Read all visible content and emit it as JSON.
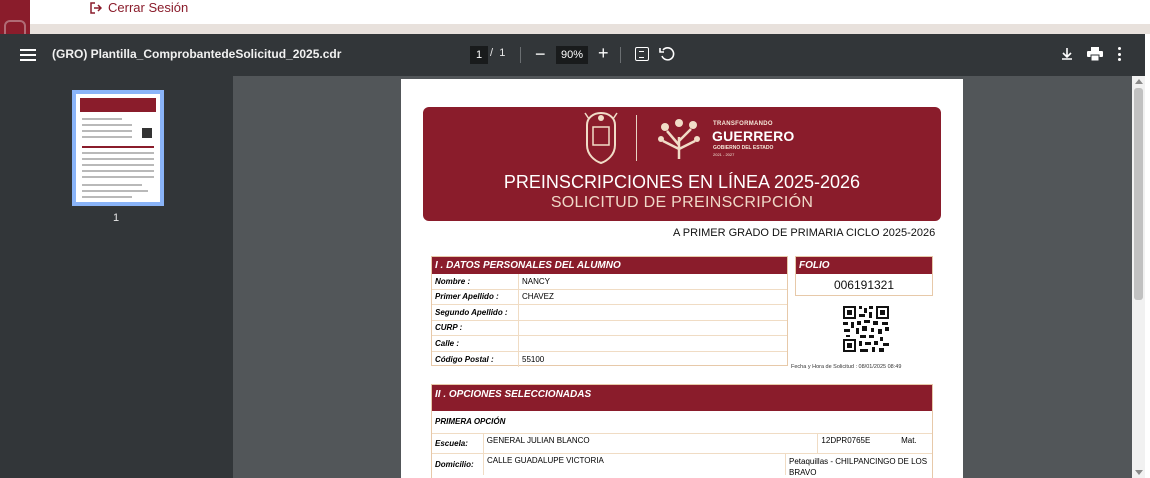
{
  "top": {
    "logout_label": "Cerrar Sesión"
  },
  "viewer": {
    "title": "(GRO) Plantilla_ComprobantedeSolicitud_2025.cdr",
    "page_current": "1",
    "page_separator": "/",
    "page_total": "1",
    "zoom": "90%",
    "thumb_number": "1"
  },
  "doc": {
    "brand_small": "TRANSFORMANDO",
    "brand_big": "GUERRERO",
    "brand_sub": "GOBIERNO DEL ESTADO",
    "brand_years": "2021 - 2027",
    "title": "PREINSCRIPCIONES EN LÍNEA 2025-2026",
    "subtitle": "SOLICITUD DE PREINSCRIPCIÓN",
    "grade_line": "A PRIMER GRADO DE PRIMARIA CICLO 2025-2026",
    "sec1_title": "I . DATOS PERSONALES DEL ALUMNO",
    "fields": [
      {
        "label": "Nombre :",
        "value": "NANCY"
      },
      {
        "label": "Primer Apellido :",
        "value": "CHAVEZ"
      },
      {
        "label": "Segundo Apellido :",
        "value": ""
      },
      {
        "label": "CURP :",
        "value": ""
      },
      {
        "label": "Calle :",
        "value": ""
      },
      {
        "label": "Código Postal :",
        "value": "55100"
      }
    ],
    "folio_title": "FOLIO",
    "folio_value": "006191321",
    "fecha": "Fecha y Hora de Solicitud : 08/01/2025 08:49",
    "sec2_title": "II . OPCIONES SELECCIONADAS",
    "option_label": "PRIMERA  OPCIÓN",
    "escuela_label": "Escuela:",
    "escuela_value": "GENERAL JULIAN BLANCO",
    "escuela_clave": "12DPR0765E",
    "escuela_turno": "Mat.",
    "domicilio_label": "Domicilio:",
    "domicilio_value": "CALLE GUADALUPE VICTORIA",
    "domicilio_localidad": "Petaquillas - CHILPANCINGO DE LOS BRAVO"
  },
  "colors": {
    "brand": "#8a1c2b",
    "toolbar": "#323639",
    "viewer_bg": "#525659",
    "thumb_border": "#8ab4f8"
  },
  "icons": [
    "logout-icon",
    "menu-icon",
    "minus-icon",
    "plus-icon",
    "fit-page-icon",
    "rotate-icon",
    "download-icon",
    "print-icon",
    "more-icon",
    "seal-icon",
    "tree-logo-icon",
    "qr-code-icon"
  ]
}
